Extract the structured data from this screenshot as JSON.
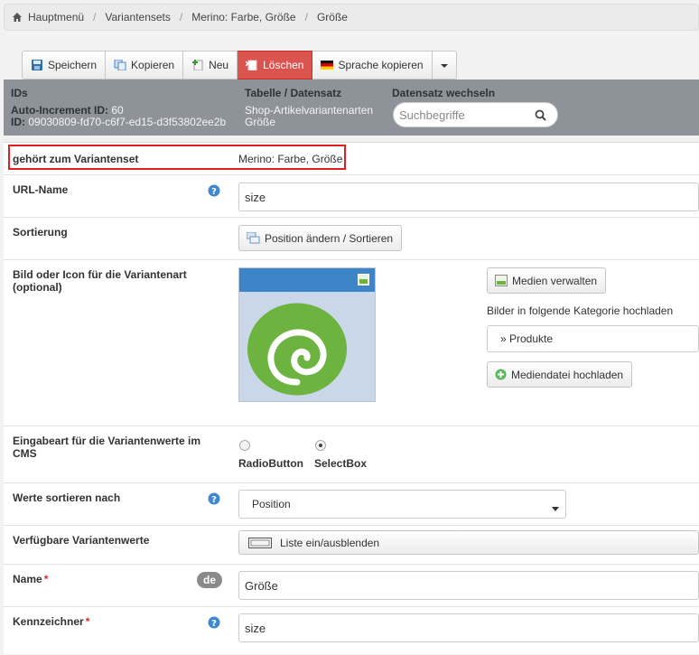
{
  "breadcrumb": [
    "Hauptmenü",
    "Variantensets",
    "Merino: Farbe, Größe",
    "Größe"
  ],
  "toolbar": {
    "save": "Speichern",
    "copy": "Kopieren",
    "new": "Neu",
    "delete": "Löschen",
    "copy_language": "Sprache kopieren"
  },
  "info": {
    "ids_title": "IDs",
    "auto_id_label": "Auto-Increment ID:",
    "auto_id_value": "60",
    "id_label": "ID:",
    "id_value": "09030809-fd70-c6f7-ed15-d3f53802ee2b",
    "table_title": "Tabelle / Datensatz",
    "table_name": "Shop-Artikelvariantenarten",
    "record_name": "Größe",
    "switch_title": "Datensatz wechseln",
    "search_placeholder": "Suchbegriffe"
  },
  "form": {
    "belongs_label": "gehört zum Variantenset",
    "belongs_value": "Merino: Farbe, Größe",
    "url_label": "URL-Name",
    "url_value": "size",
    "sort_label": "Sortierung",
    "sort_button": "Position ändern / Sortieren",
    "image_label": "Bild oder Icon für die Variantenart (optional)",
    "media_manage": "Medien verwalten",
    "upload_category_text": "Bilder in folgende Kategorie hochladen",
    "category_value": "» Produkte",
    "upload_button": "Mediendatei hochladen",
    "input_type_label": "Eingabeart für die Variantenwerte im CMS",
    "radio_option": "RadioButton",
    "select_option": "SelectBox",
    "sort_values_label": "Werte sortieren nach",
    "sort_values_value": "Position",
    "available_label": "Verfügbare Variantenwerte",
    "toggle_list": "Liste ein/ausblenden",
    "name_label": "Name",
    "name_lang": "de",
    "name_value": "Größe",
    "identifier_label": "Kennzeichner",
    "identifier_value": "size"
  },
  "colors": {
    "danger": "#d9534f",
    "band": "#8e9399",
    "highlight": "#e02020",
    "preview_bar": "#3d85c6",
    "logo_green": "#6cb33f"
  }
}
